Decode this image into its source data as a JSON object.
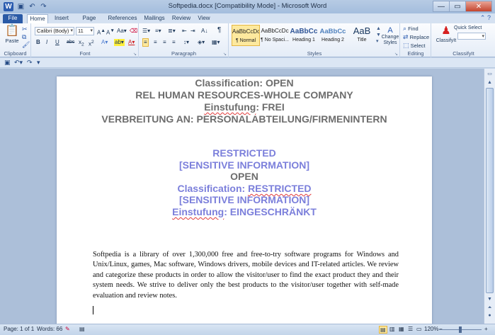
{
  "window": {
    "title": "Softpedia.docx [Compatibility Mode] - Microsoft Word",
    "minimize": "—",
    "maximize": "▭",
    "close": "✕",
    "app_icon_letter": "W"
  },
  "quick_access": {
    "save_icon": "save-icon",
    "undo_icon": "undo-icon",
    "redo_icon": "redo-icon"
  },
  "tabs": [
    {
      "label": "File"
    },
    {
      "label": "Home"
    },
    {
      "label": "Insert"
    },
    {
      "label": "Page Layout"
    },
    {
      "label": "References"
    },
    {
      "label": "Mailings"
    },
    {
      "label": "Review"
    },
    {
      "label": "View"
    }
  ],
  "ribbon": {
    "clipboard": {
      "label": "Clipboard",
      "paste": "Paste"
    },
    "font": {
      "label": "Font",
      "family": "Calibri (Body)",
      "size": "11",
      "bold": "B",
      "italic": "I",
      "underline": "U",
      "strike": "abc"
    },
    "paragraph": {
      "label": "Paragraph",
      "pilcrow": "¶"
    },
    "styles": {
      "label": "Styles",
      "items": [
        {
          "sample": "AaBbCcDc",
          "name": "¶ Normal"
        },
        {
          "sample": "AaBbCcDc",
          "name": "¶ No Spaci..."
        },
        {
          "sample": "AaBbCc",
          "name": "Heading 1"
        },
        {
          "sample": "AaBbCc",
          "name": "Heading 2"
        },
        {
          "sample": "AaB",
          "name": "Title"
        }
      ],
      "change_styles": "Change Styles"
    },
    "editing": {
      "label": "Editing",
      "find": "Find",
      "replace": "Replace",
      "select": "Select"
    },
    "classifyit": {
      "label": "ClassifyIt",
      "button": "ClassifyIt",
      "quick_select": "Quick Select"
    }
  },
  "document": {
    "header_lines": [
      "Classification: OPEN",
      "REL HUMAN RESOURCES-WHOLE COMPANY",
      "Einstufung: FREI",
      "VERBREITUNG AN: PERSONALABTEILUNG/FIRMENINTERN"
    ],
    "classification_lines": [
      "RESTRICTED",
      "[SENSITIVE INFORMATION]",
      "OPEN",
      "Classification: RESTRICTED",
      "[SENSITIVE INFORMATION]",
      "Einstufung: EINGESCHRÄNKT"
    ],
    "body": "Softpedia is a library of over 1,300,000 free and free-to-try software programs for Windows and Unix/Linux, games, Mac software, Windows drivers, mobile devices and IT-related articles. We review and categorize these products in order to allow the visitor/user to find the exact product they and their system needs. We strive to deliver only the best products to the visitor/user together with self-made evaluation and review notes."
  },
  "statusbar": {
    "page": "Page: 1 of 1",
    "words": "Words: 66",
    "zoom": "120%",
    "zoom_minus": "−",
    "zoom_plus": "+"
  },
  "colors": {
    "header_gray": "#6d6d6d",
    "classification_purple": "#7b7fdb",
    "file_tab": "#2a5aa6"
  }
}
